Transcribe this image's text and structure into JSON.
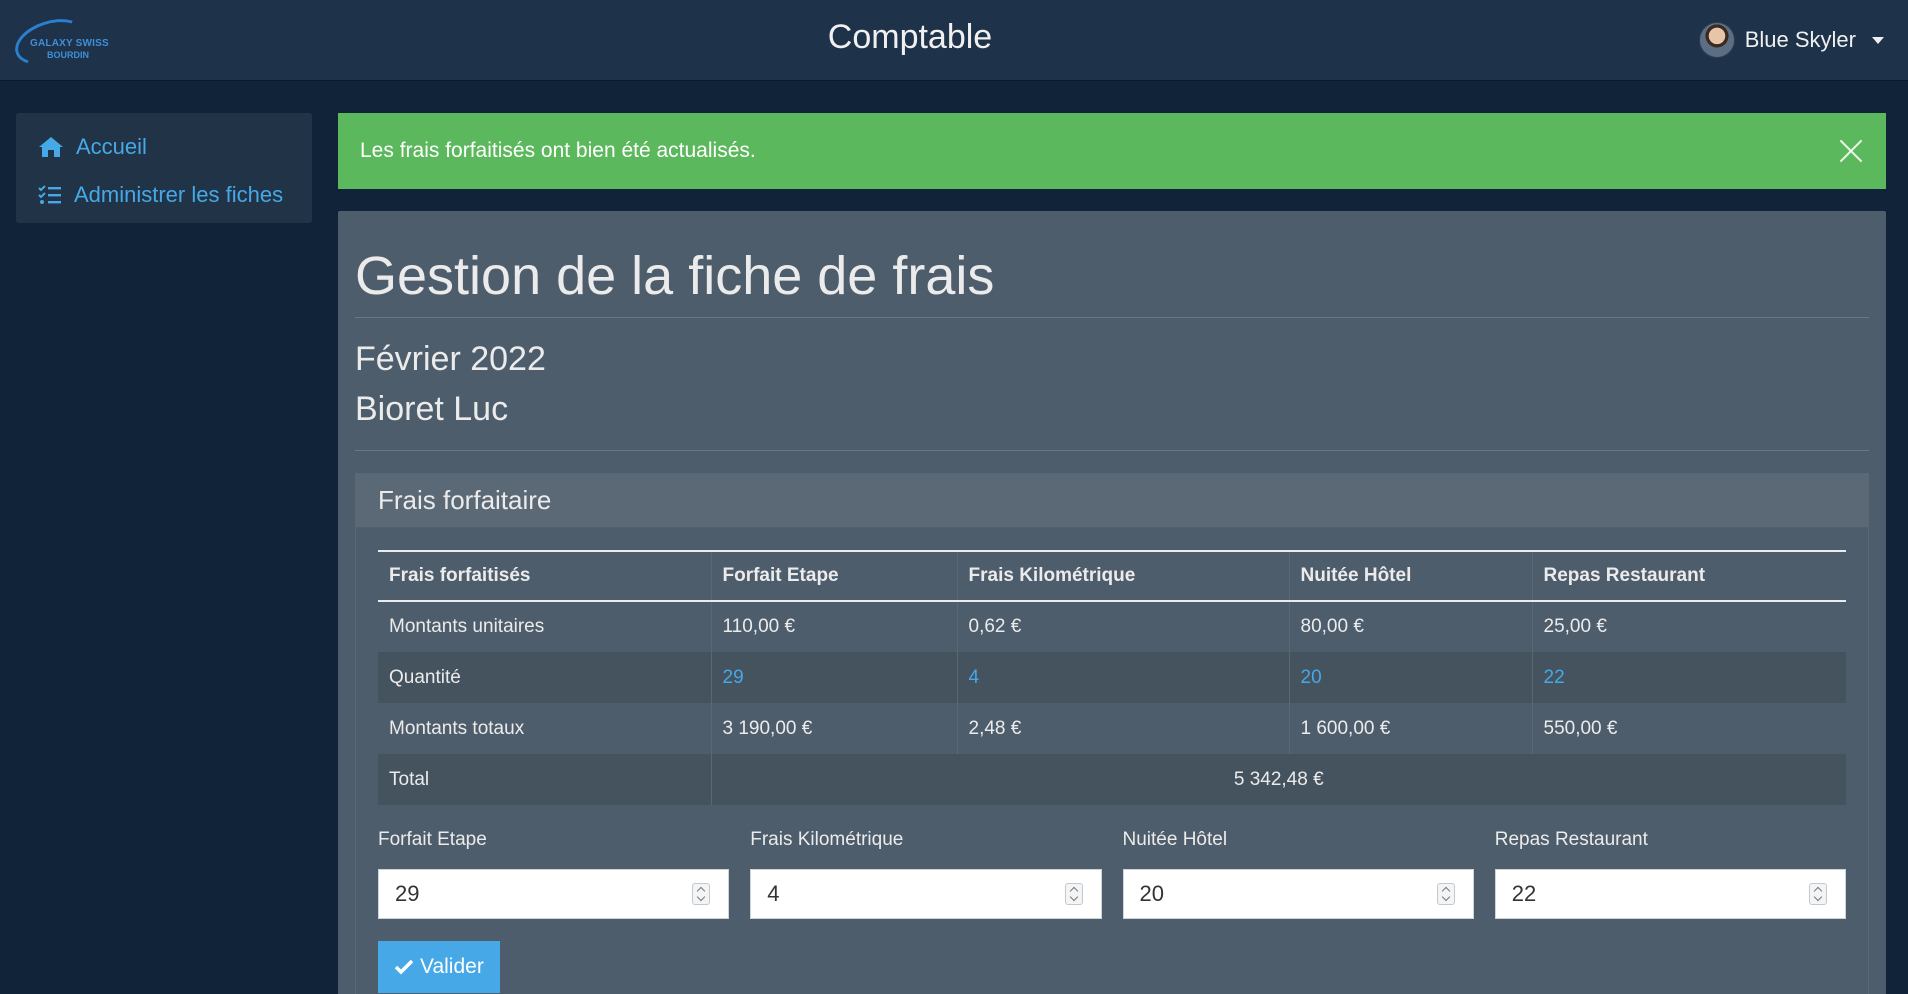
{
  "header": {
    "logo_line1": "GALAXY SWISS",
    "logo_line2": "BOURDIN",
    "title": "Comptable",
    "user_name": "Blue Skyler"
  },
  "sidebar": {
    "items": [
      {
        "label": "Accueil",
        "icon": "home-icon"
      },
      {
        "label": "Administrer les fiches",
        "icon": "list-check-icon"
      }
    ]
  },
  "alert": {
    "message": "Les frais forfaitisés ont bien été actualisés."
  },
  "main": {
    "title": "Gestion de la fiche de frais",
    "month": "Février 2022",
    "person": "Bioret Luc",
    "card_title": "Frais forfaitaire",
    "table": {
      "headers": [
        "Frais forfaitisés",
        "Forfait Etape",
        "Frais Kilométrique",
        "Nuitée Hôtel",
        "Repas Restaurant"
      ],
      "rows": [
        [
          "Montants unitaires",
          "110,00 €",
          "0,62 €",
          "80,00 €",
          "25,00 €"
        ],
        [
          "Quantité",
          "29",
          "4",
          "20",
          "22"
        ],
        [
          "Montants totaux",
          "3 190,00 €",
          "2,48 €",
          "1 600,00 €",
          "550,00 €"
        ]
      ],
      "total_label": "Total",
      "total_value": "5 342,48 €"
    },
    "fields": [
      {
        "label": "Forfait Etape",
        "value": "29"
      },
      {
        "label": "Frais Kilométrique",
        "value": "4"
      },
      {
        "label": "Nuitée Hôtel",
        "value": "20"
      },
      {
        "label": "Repas Restaurant",
        "value": "22"
      }
    ],
    "submit_label": "Valider"
  },
  "colors": {
    "background": "#102339",
    "topbar": "#1e3249",
    "panel": "#4e5d6c",
    "alert_success": "#5cb85c",
    "link": "#46a8e6"
  }
}
